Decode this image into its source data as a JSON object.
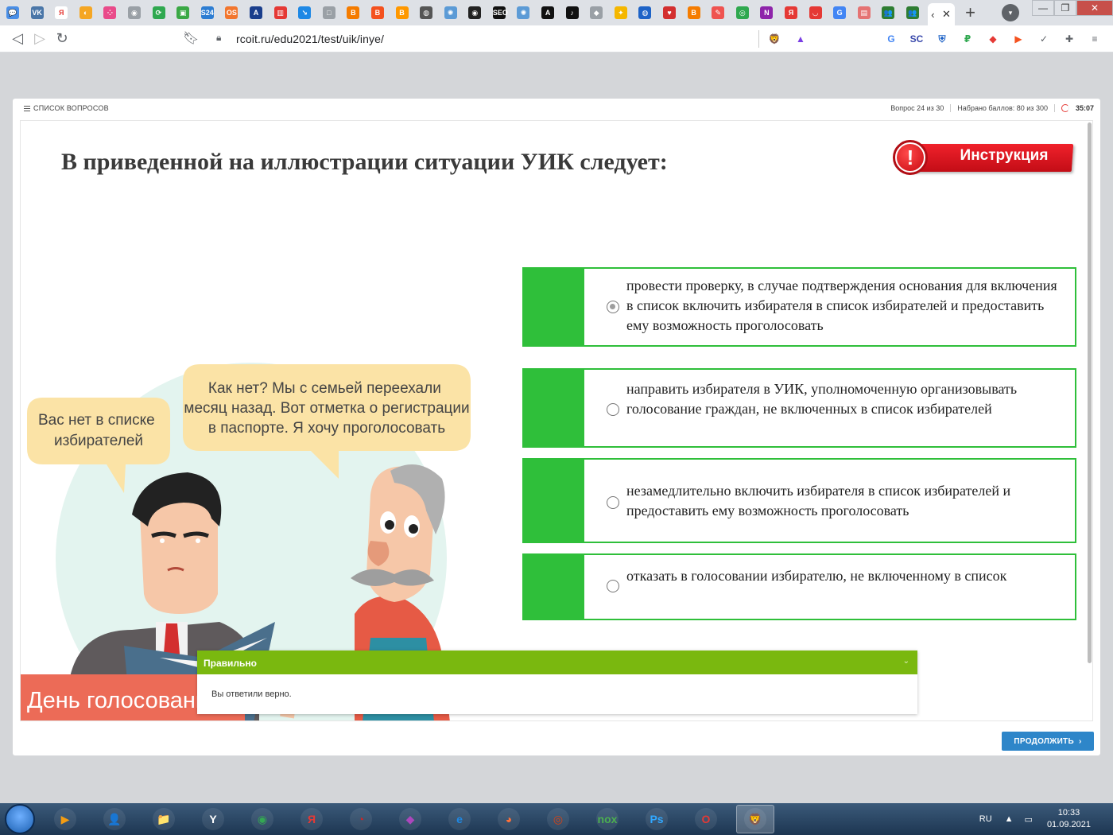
{
  "browser": {
    "url": "rcoit.ru/edu2021/test/uik/inye/",
    "tab_icons": [
      {
        "name": "messenger-icon",
        "color": "#4a8fe7",
        "glyph": "💬"
      },
      {
        "name": "vk-icon",
        "color": "#4a76a8",
        "glyph": "VK"
      },
      {
        "name": "yandex-icon",
        "color": "#ffffff",
        "glyph": "Я"
      },
      {
        "name": "swirl-icon",
        "color": "#f5a623",
        "glyph": "◐"
      },
      {
        "name": "dots-icon",
        "color": "#e94b8a",
        "glyph": "⁘"
      },
      {
        "name": "eye-icon",
        "color": "#9aa0a6",
        "glyph": "◉"
      },
      {
        "name": "refresh-green-icon",
        "color": "#2fa84f",
        "glyph": "⟳"
      },
      {
        "name": "green-square-icon",
        "color": "#3aa845",
        "glyph": "▣"
      },
      {
        "name": "serp24-icon",
        "color": "#2d7dd2",
        "glyph": "S24"
      },
      {
        "name": "onlysure-icon",
        "color": "#f2762e",
        "glyph": "OS"
      },
      {
        "name": "chart-icon",
        "color": "#1a3e8c",
        "glyph": "A"
      },
      {
        "name": "bars-icon",
        "color": "#e53935",
        "glyph": "▥"
      },
      {
        "name": "pin-icon",
        "color": "#1e88e5",
        "glyph": "↘"
      },
      {
        "name": "box-icon",
        "color": "#9aa0a6",
        "glyph": "□"
      },
      {
        "name": "blogger-icon",
        "color": "#f57c00",
        "glyph": "B"
      },
      {
        "name": "b-icon",
        "color": "#f4511e",
        "glyph": "B"
      },
      {
        "name": "blogger2-icon",
        "color": "#ff9800",
        "glyph": "B"
      },
      {
        "name": "globe-icon",
        "color": "#555555",
        "glyph": "◍"
      },
      {
        "name": "atom-icon",
        "color": "#5c9bd6",
        "glyph": "✺"
      },
      {
        "name": "eye-dark-icon",
        "color": "#222222",
        "glyph": "◉"
      },
      {
        "name": "seo-icon",
        "color": "#111111",
        "glyph": "SEO"
      },
      {
        "name": "atom2-icon",
        "color": "#5c9bd6",
        "glyph": "✺"
      },
      {
        "name": "a-icon",
        "color": "#111111",
        "glyph": "A"
      },
      {
        "name": "tiktok-icon",
        "color": "#111111",
        "glyph": "♪"
      },
      {
        "name": "cube-icon",
        "color": "#9aa0a6",
        "glyph": "◆"
      },
      {
        "name": "bird-icon",
        "color": "#f5b700",
        "glyph": "✦"
      },
      {
        "name": "globe2-icon",
        "color": "#1e63c7",
        "glyph": "◍"
      },
      {
        "name": "heart-icon",
        "color": "#d32f2f",
        "glyph": "♥"
      },
      {
        "name": "blogger3-icon",
        "color": "#f57c00",
        "glyph": "B"
      },
      {
        "name": "pencil-icon",
        "color": "#ef5350",
        "glyph": "✎"
      },
      {
        "name": "ring-icon",
        "color": "#2fa84f",
        "glyph": "◎"
      },
      {
        "name": "n-icon",
        "color": "#8e24aa",
        "glyph": "N"
      },
      {
        "name": "yandex2-icon",
        "color": "#e53935",
        "glyph": "Я"
      },
      {
        "name": "pocket-icon",
        "color": "#e53935",
        "glyph": "◡"
      },
      {
        "name": "google-icon",
        "color": "#4285f4",
        "glyph": "G"
      },
      {
        "name": "doc-icon",
        "color": "#e57373",
        "glyph": "▤"
      },
      {
        "name": "people-icon",
        "color": "#2e7d32",
        "glyph": "👥"
      },
      {
        "name": "people2-icon",
        "color": "#2e7d32",
        "glyph": "👥"
      }
    ],
    "active_tab": {
      "icon": "‹",
      "close": "✕"
    },
    "window_controls": [
      "—",
      "❐",
      "✕"
    ],
    "extensions": [
      {
        "name": "brave-shield-icon",
        "glyph": "🦁",
        "color": "#fb542b"
      },
      {
        "name": "brave-rewards-icon",
        "glyph": "▲",
        "color": "#7b3fe4"
      },
      {
        "name": "translate-icon",
        "glyph": "G",
        "color": "#4285f4"
      },
      {
        "name": "sc-icon",
        "glyph": "SC",
        "color": "#3949ab"
      },
      {
        "name": "shield-person-icon",
        "glyph": "⛨",
        "color": "#1e63c7"
      },
      {
        "name": "p-icon",
        "glyph": "₽",
        "color": "#2fa84f"
      },
      {
        "name": "cube-color-icon",
        "glyph": "◆",
        "color": "#e53935"
      },
      {
        "name": "play-icon",
        "glyph": "▶",
        "color": "#f4511e"
      },
      {
        "name": "check-shield-icon",
        "glyph": "✓",
        "color": "#5f6368"
      },
      {
        "name": "puzzle-icon",
        "glyph": "✚",
        "color": "#5f6368"
      },
      {
        "name": "menu-icon",
        "glyph": "≡",
        "color": "#5f6368"
      }
    ]
  },
  "quiz": {
    "question_list_label": "СПИСОК ВОПРОСОВ",
    "question_counter": "Вопрос 24 из 30",
    "score": "Набрано баллов: 80 из 300",
    "timer": "35:07",
    "title": "В приведенной на иллюстрации ситуации УИК следует:",
    "instruction_label": "Инструкция",
    "illustration": {
      "bubble_left": "Вас нет в списке избирателей",
      "bubble_right": "Как нет? Мы с семьей переехали месяц назад. Вот отметка о регистрации в паспорте. Я хочу проголосовать",
      "banner": "День голосования"
    },
    "answers": [
      {
        "text": "провести проверку, в случае подтверждения основания для включения в список включить избирателя в список избирателей и предоставить ему возможность проголосовать",
        "selected": true
      },
      {
        "text": "направить избирателя в УИК, уполномоченную организовывать голосование граждан, не включенных в список избирателей",
        "selected": false
      },
      {
        "text": "незамедлительно включить избирателя в список избирателей и предоставить ему возможность проголосовать",
        "selected": false
      },
      {
        "text": "отказать в голосовании избирателю, не включенному в список",
        "selected": false
      }
    ],
    "feedback": {
      "title": "Правильно",
      "message": "Вы ответили верно."
    },
    "continue_label": "ПРОДОЛЖИТЬ"
  },
  "taskbar": {
    "apps": [
      {
        "name": "media-player-icon",
        "glyph": "▶",
        "color": "#f39c12"
      },
      {
        "name": "user-folder-icon",
        "glyph": "👤",
        "color": "#e0b35a"
      },
      {
        "name": "explorer-icon",
        "glyph": "📁",
        "color": "#f2c94c"
      },
      {
        "name": "yandex-browser-icon",
        "glyph": "Y",
        "color": "#ffffff"
      },
      {
        "name": "chrome-icon",
        "glyph": "◉",
        "color": "#34a853"
      },
      {
        "name": "yandex-icon",
        "glyph": "Я",
        "color": "#e53935"
      },
      {
        "name": "comodo-icon",
        "glyph": "◔",
        "color": "#c62828"
      },
      {
        "name": "polygon-icon",
        "glyph": "◆",
        "color": "#ab47bc"
      },
      {
        "name": "ie-icon",
        "glyph": "e",
        "color": "#1e88e5"
      },
      {
        "name": "firefox-icon",
        "glyph": "◕",
        "color": "#ff7139"
      },
      {
        "name": "chromium-icon",
        "glyph": "◎",
        "color": "#d84315"
      },
      {
        "name": "nox-icon",
        "glyph": "nox",
        "color": "#4caf50"
      },
      {
        "name": "photoshop-icon",
        "glyph": "Ps",
        "color": "#31a8ff"
      },
      {
        "name": "opera-icon",
        "glyph": "O",
        "color": "#e53935"
      },
      {
        "name": "brave-icon",
        "glyph": "🦁",
        "color": "#fb542b"
      }
    ],
    "language": "RU",
    "time": "10:33",
    "date": "01.09.2021"
  },
  "colors": {
    "answer_green": "#2fbf3a",
    "feedback_green": "#7ab80f",
    "continue_blue": "#2e86c9",
    "instruction_red": "#e01d25"
  }
}
